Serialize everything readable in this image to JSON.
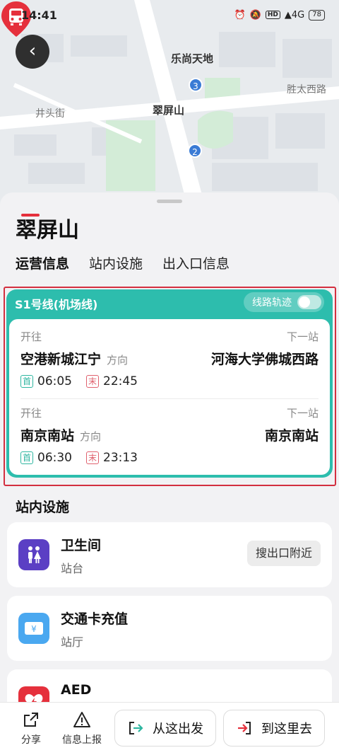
{
  "status_bar": {
    "time": "14:41",
    "network": "4G",
    "battery": "78"
  },
  "map": {
    "labels": {
      "poi": "乐尚天地",
      "road_east": "胜太西路",
      "road_west": "井头街",
      "station": "翠屏山"
    },
    "exits": [
      "3",
      "2"
    ],
    "colors": {
      "pin": "#e5303c",
      "exit_marker": "#3a7bd5"
    }
  },
  "station": {
    "name": "翠屏山"
  },
  "tabs": [
    {
      "label": "运营信息",
      "active": true
    },
    {
      "label": "站内设施",
      "active": false
    },
    {
      "label": "出入口信息",
      "active": false
    }
  ],
  "line": {
    "name": "S1号线(机场线)",
    "color": "#2dbdad",
    "track_toggle_label": "线路轨迹",
    "track_toggle_on": false,
    "directions": [
      {
        "toward_label": "开往",
        "next_label": "下一站",
        "destination": "空港新城江宁",
        "direction_word": "方向",
        "next_station": "河海大学佛城西路",
        "first_tag": "首",
        "first_time": "06:05",
        "last_tag": "末",
        "last_time": "22:45"
      },
      {
        "toward_label": "开往",
        "next_label": "下一站",
        "destination": "南京南站",
        "direction_word": "方向",
        "next_station": "南京南站",
        "first_tag": "首",
        "first_time": "06:30",
        "last_tag": "末",
        "last_time": "23:13"
      }
    ]
  },
  "facilities": {
    "title": "站内设施",
    "items": [
      {
        "name": "卫生间",
        "location": "站台",
        "icon": "restroom-icon",
        "icon_color": "#5b3fc4",
        "action": "搜出口附近"
      },
      {
        "name": "交通卡充值",
        "location": "站厅",
        "icon": "transit-card-icon",
        "icon_color": "#4aa8f0"
      },
      {
        "name": "AED",
        "location": "",
        "icon": "aed-icon",
        "icon_color": "#e5303c"
      }
    ]
  },
  "bottom_bar": {
    "share_label": "分享",
    "report_label": "信息上报",
    "from_label": "从这出发",
    "to_label": "到这里去"
  }
}
